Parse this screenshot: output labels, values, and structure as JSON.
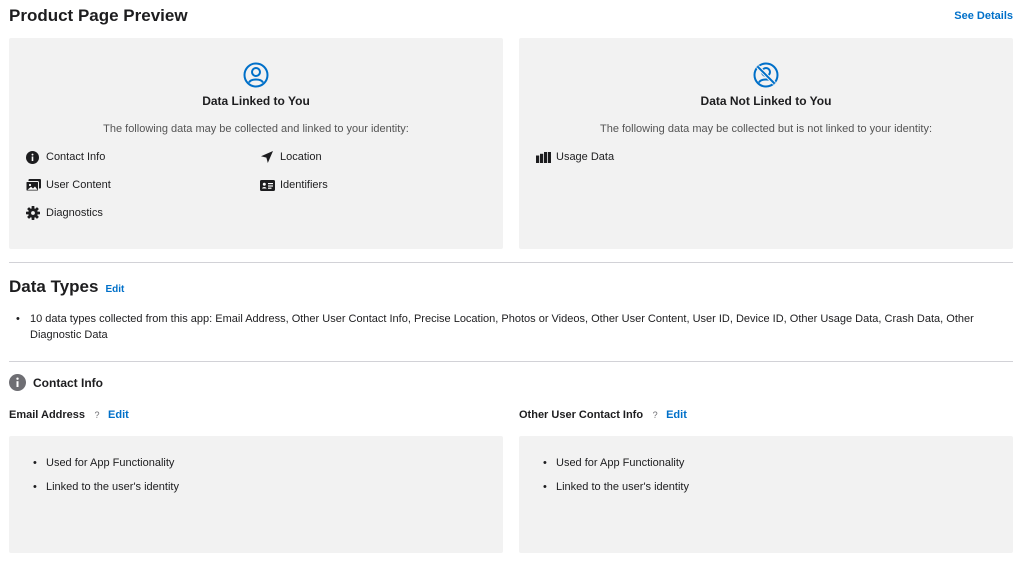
{
  "header": {
    "title": "Product Page Preview",
    "see_details": "See Details"
  },
  "linked": {
    "icon": "person-circle-icon",
    "title": "Data Linked to You",
    "description": "The following data may be collected and linked to your identity:",
    "categories": [
      {
        "label": "Contact Info",
        "icon": "info-icon"
      },
      {
        "label": "Location",
        "icon": "location-arrow-icon"
      },
      {
        "label": "User Content",
        "icon": "photo-icon"
      },
      {
        "label": "Identifiers",
        "icon": "id-card-icon"
      },
      {
        "label": "Diagnostics",
        "icon": "gear-icon"
      }
    ]
  },
  "not_linked": {
    "icon": "person-slash-icon",
    "title": "Data Not Linked to You",
    "description": "The following data may be collected but is not linked to your identity:",
    "categories": [
      {
        "label": "Usage Data",
        "icon": "bar-chart-icon"
      }
    ]
  },
  "data_types": {
    "title": "Data Types",
    "edit": "Edit",
    "summary": "10 data types collected from this app: Email Address, Other User Contact Info, Precise Location, Photos or Videos, Other User Content, User ID, Device ID, Other Usage Data, Crash Data, Other Diagnostic Data"
  },
  "contact_info": {
    "title": "Contact Info",
    "icon": "info-icon",
    "fields": [
      {
        "name": "Email Address",
        "help": "?",
        "edit": "Edit",
        "purposes": [
          "Used for App Functionality",
          "Linked to the user's identity"
        ]
      },
      {
        "name": "Other User Contact Info",
        "help": "?",
        "edit": "Edit",
        "purposes": [
          "Used for App Functionality",
          "Linked to the user's identity"
        ]
      }
    ]
  },
  "colors": {
    "accent": "#0070c9",
    "card_bg": "#f2f2f2",
    "divider": "#d2d2d7"
  }
}
